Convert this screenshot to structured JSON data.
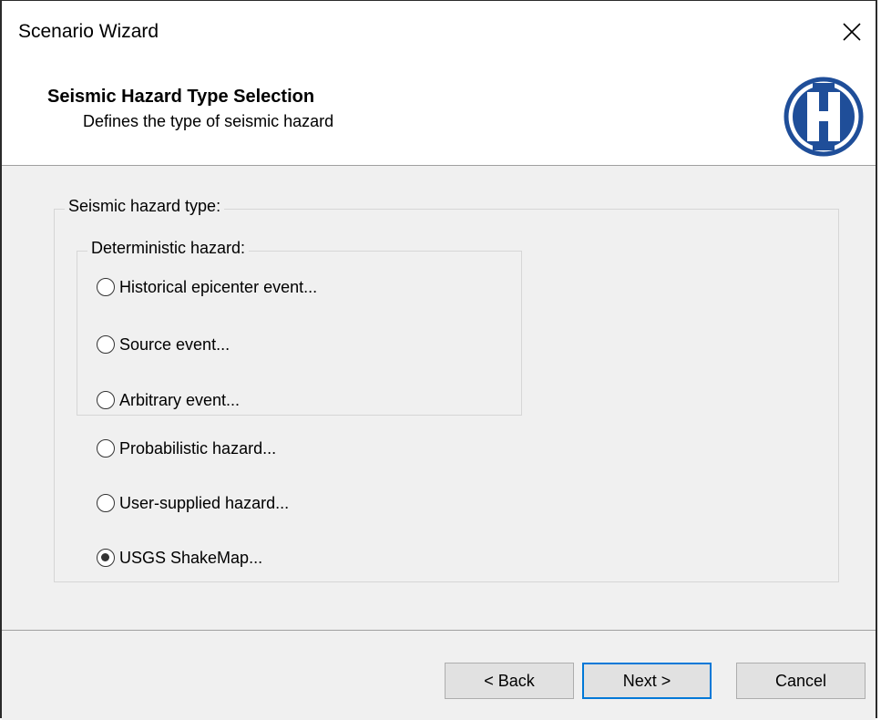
{
  "window": {
    "title": "Scenario Wizard"
  },
  "header": {
    "title": "Seismic Hazard Type Selection",
    "subtitle": "Defines the type of seismic hazard"
  },
  "hazard_group": {
    "label": "Seismic hazard type:",
    "deterministic_group": {
      "label": "Deterministic hazard:",
      "options": [
        {
          "label": "Historical epicenter event...",
          "checked": false
        },
        {
          "label": "Source event...",
          "checked": false
        },
        {
          "label": "Arbitrary event...",
          "checked": false
        }
      ]
    },
    "other_options": [
      {
        "label": "Probabilistic hazard...",
        "checked": false
      },
      {
        "label": "User-supplied hazard...",
        "checked": false
      },
      {
        "label": "USGS ShakeMap...",
        "checked": true
      }
    ]
  },
  "buttons": {
    "back": "< Back",
    "next": "Next >",
    "cancel": "Cancel"
  },
  "icons": {
    "close": "close-icon",
    "logo": "hazus-logo-icon"
  },
  "colors": {
    "logo_blue": "#1f4e99",
    "accent": "#0078d7"
  }
}
